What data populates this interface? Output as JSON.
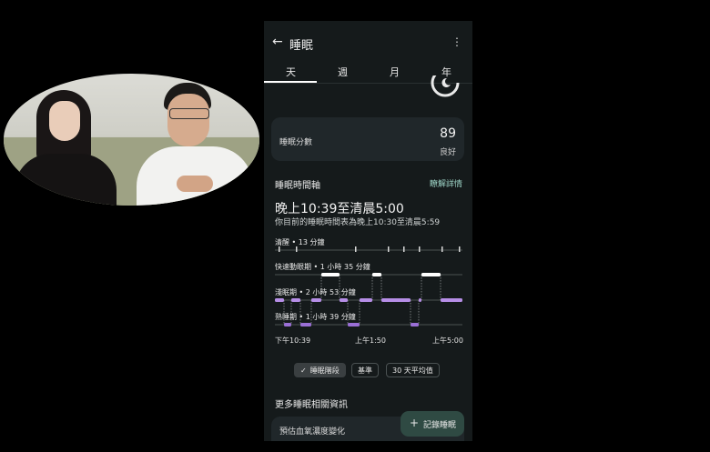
{
  "header": {
    "title": "睡眠",
    "back_icon": "arrow-left-icon",
    "menu_icon": "more-vert-icon"
  },
  "tabs": [
    {
      "label": "天"
    },
    {
      "label": "週"
    },
    {
      "label": "月"
    },
    {
      "label": "年"
    }
  ],
  "score_card": {
    "label": "睡眠分數",
    "value": "89",
    "rating": "良好"
  },
  "timeline": {
    "title": "睡眠時間軸",
    "details_link": "瞭解詳情",
    "range": "晚上10:39至清晨5:00",
    "schedule_note": "你目前的睡眠時間表為晚上10:30至清晨5:59",
    "stages": [
      {
        "label": "清醒 • 13 分鐘"
      },
      {
        "label": "快速動眼期 • 1 小時 35 分鐘"
      },
      {
        "label": "淺眠期 • 2 小時 53 分鐘"
      },
      {
        "label": "熟睡期 • 1 小時 39 分鐘"
      }
    ],
    "x_labels": [
      "下午10:39",
      "上午1:50",
      "上午5:00"
    ],
    "colors": {
      "light": "#b68ee6",
      "rem": "#ffffff",
      "deep": "#9a6fd6",
      "awake": "#d9d9d9"
    }
  },
  "chips": [
    {
      "label": "睡眠階段",
      "active": true
    },
    {
      "label": "基準",
      "active": false
    },
    {
      "label": "30 天平均值",
      "active": false
    }
  ],
  "more_section": {
    "title": "更多睡眠相關資訊",
    "card_label": "預估血氧濃度變化"
  },
  "fab": {
    "label": "記錄睡眠"
  }
}
